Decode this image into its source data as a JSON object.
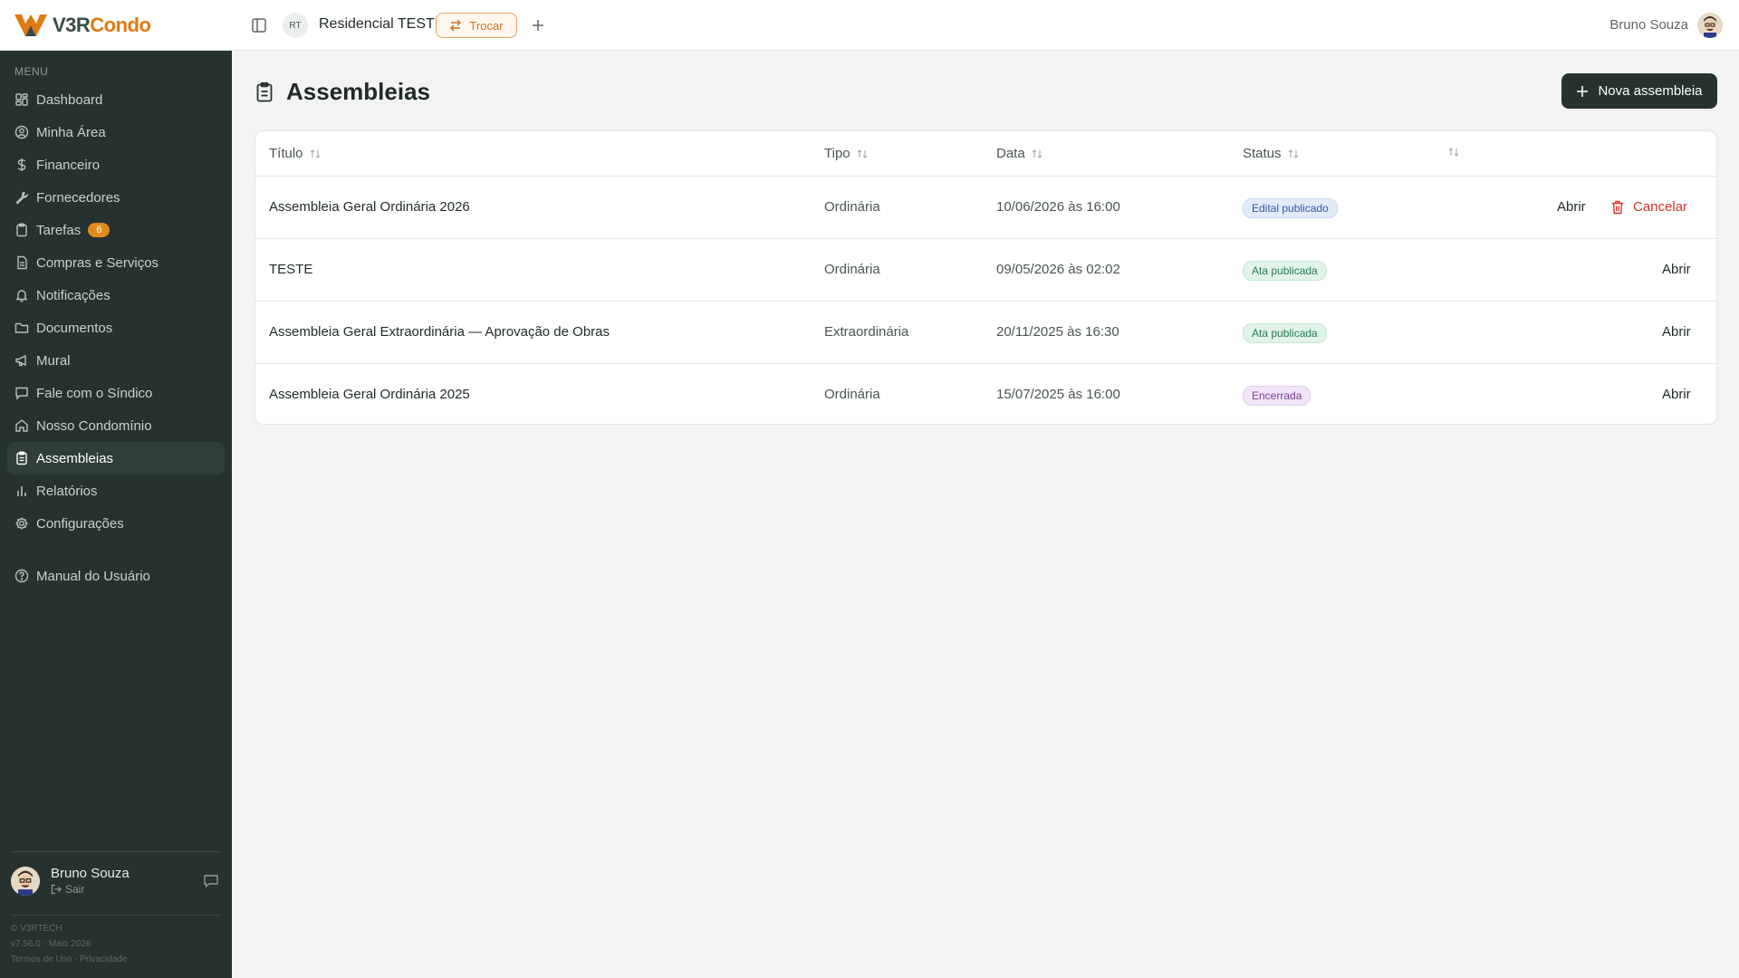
{
  "brand": {
    "part1": "V3R",
    "part2": "Condo"
  },
  "header": {
    "condo_initials": "RT",
    "condo_name": "Residencial TESTE",
    "switch_label": "Trocar",
    "user_name": "Bruno Souza"
  },
  "sidebar": {
    "menu_label": "MENU",
    "items": [
      {
        "label": "Dashboard",
        "icon": "dashboard-icon"
      },
      {
        "label": "Minha Área",
        "icon": "user-circle-icon"
      },
      {
        "label": "Financeiro",
        "icon": "dollar-icon"
      },
      {
        "label": "Fornecedores",
        "icon": "wrench-icon"
      },
      {
        "label": "Tarefas",
        "icon": "clipboard-icon",
        "badge": "6"
      },
      {
        "label": "Compras e Serviços",
        "icon": "document-icon"
      },
      {
        "label": "Notificações",
        "icon": "bell-icon"
      },
      {
        "label": "Documentos",
        "icon": "folder-icon"
      },
      {
        "label": "Mural",
        "icon": "megaphone-icon"
      },
      {
        "label": "Fale com o Síndico",
        "icon": "message-icon"
      },
      {
        "label": "Nosso Condomínio",
        "icon": "home-icon"
      },
      {
        "label": "Assembleias",
        "icon": "clipboard-list-icon",
        "active": true
      },
      {
        "label": "Relatórios",
        "icon": "bar-chart-icon"
      },
      {
        "label": "Configurações",
        "icon": "gear-icon"
      }
    ],
    "help_label": "Manual do Usuário",
    "user_name": "Bruno Souza",
    "logout_label": "Sair",
    "copyright": "© V3RTECH",
    "version": "v7.56.0 · Maio 2026",
    "terms": "Termos de Uso",
    "privacy": "Privacidade"
  },
  "page": {
    "title": "Assembleias",
    "new_button": "Nova assembleia"
  },
  "table": {
    "columns": [
      "Título",
      "Tipo",
      "Data",
      "Status"
    ],
    "rows": [
      {
        "titulo": "Assembleia Geral Ordinária 2026",
        "tipo": "Ordinária",
        "data": "10/06/2026 às 16:00",
        "status": "Edital publicado",
        "status_kind": "edital",
        "open": "Abrir",
        "cancel": "Cancelar"
      },
      {
        "titulo": "TESTE",
        "tipo": "Ordinária",
        "data": "09/05/2026 às 02:02",
        "status": "Ata publicada",
        "status_kind": "ata",
        "open": "Abrir"
      },
      {
        "titulo": "Assembleia Geral Extraordinária — Aprovação de Obras",
        "tipo": "Extraordinária",
        "data": "20/11/2025 às 16:30",
        "status": "Ata publicada",
        "status_kind": "ata",
        "open": "Abrir"
      },
      {
        "titulo": "Assembleia Geral Ordinária 2025",
        "tipo": "Ordinária",
        "data": "15/07/2025 às 16:00",
        "status": "Encerrada",
        "status_kind": "encerrada",
        "open": "Abrir"
      }
    ]
  },
  "colors": {
    "sidebar_bg": "#253230",
    "accent": "#e07a10",
    "danger": "#d0342c"
  }
}
